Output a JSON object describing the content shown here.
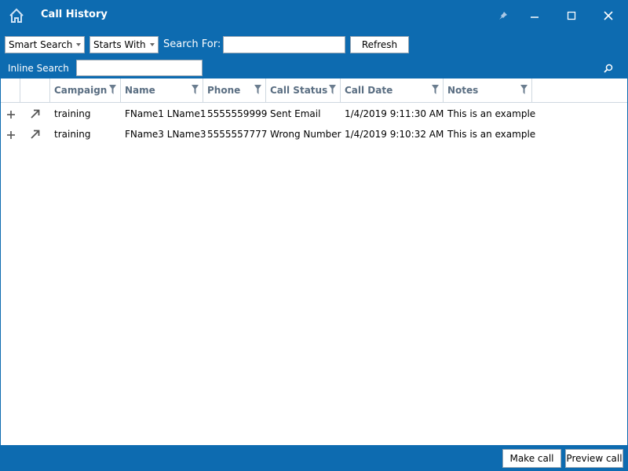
{
  "window": {
    "title": "Call History",
    "icons": {
      "home": "home-icon",
      "pin": "pin-icon",
      "minimize": "minimize-icon",
      "maximize": "maximize-icon",
      "close": "close-icon"
    }
  },
  "toolbar": {
    "search_mode": "Smart Search",
    "match_mode": "Starts With",
    "search_for_label": "Search For:",
    "search_value": "",
    "refresh_label": "Refresh",
    "inline_search_label": "Inline Search",
    "inline_search_value": ""
  },
  "table": {
    "columns": [
      "Campaign",
      "Name",
      "Phone",
      "Call Status",
      "Call Date",
      "Notes"
    ],
    "rows": [
      {
        "campaign": "training",
        "name": "FName1 LName1",
        "phone": "5555559999",
        "status": "Sent Email",
        "date": "1/4/2019 9:11:30 AM",
        "notes": "This is an example"
      },
      {
        "campaign": "training",
        "name": "FName3 LName3",
        "phone": "5555557777",
        "status": "Wrong Number",
        "date": "1/4/2019 9:10:32 AM",
        "notes": "This is an example"
      }
    ]
  },
  "footer": {
    "make_call_label": "Make call",
    "preview_call_label": "Preview call"
  },
  "colors": {
    "accent": "#0d6bb0",
    "header_text": "#5a6e82"
  }
}
